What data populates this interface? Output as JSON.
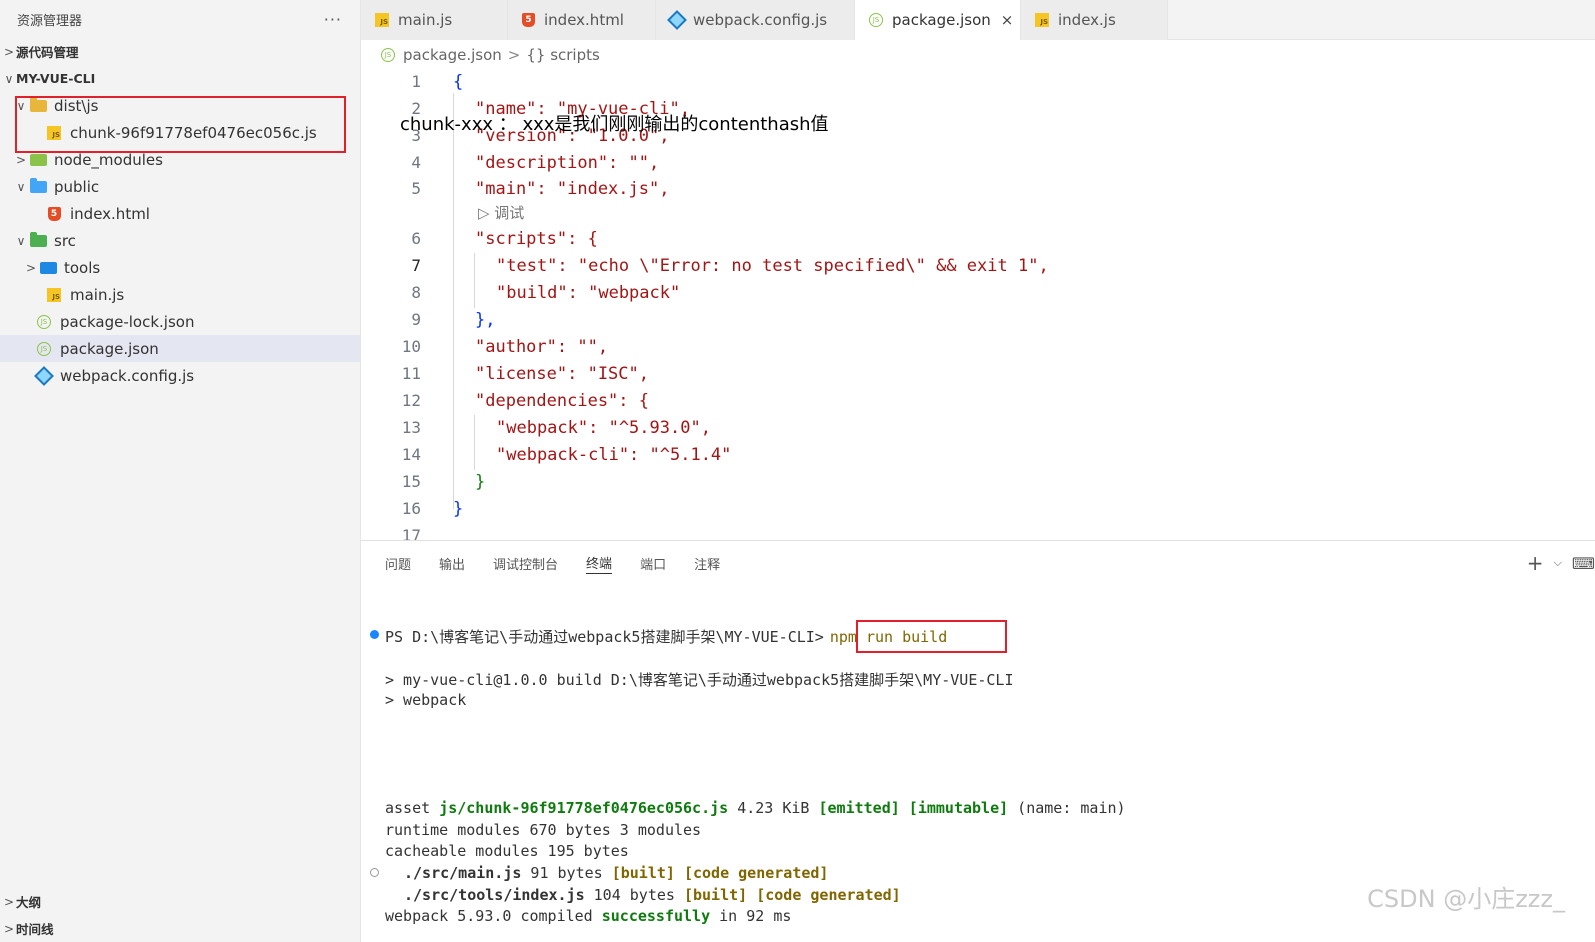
{
  "sidebar": {
    "title": "资源管理器",
    "more": "···",
    "sections": {
      "scm": "源代码管理",
      "project": "MY-VUE-CLI",
      "outline": "大纲",
      "timeline": "时间线"
    },
    "tree": [
      {
        "label": "dist\\js",
        "chev": "∨",
        "type": "folder"
      },
      {
        "label": "chunk-96f91778ef0476ec056c.js",
        "type": "js"
      },
      {
        "label": "node_modules",
        "chev": ">",
        "type": "folder"
      },
      {
        "label": "public",
        "chev": "∨",
        "type": "folder"
      },
      {
        "label": "index.html",
        "type": "html"
      },
      {
        "label": "src",
        "chev": "∨",
        "type": "folder"
      },
      {
        "label": "tools",
        "chev": ">",
        "type": "folder"
      },
      {
        "label": "main.js",
        "type": "js"
      },
      {
        "label": "package-lock.json",
        "type": "npm"
      },
      {
        "label": "package.json",
        "type": "npm",
        "selected": true
      },
      {
        "label": "webpack.config.js",
        "type": "webpack"
      }
    ]
  },
  "tabs": [
    {
      "label": "main.js",
      "icon": "js-icon"
    },
    {
      "label": "index.html",
      "icon": "html-icon"
    },
    {
      "label": "webpack.config.js",
      "icon": "webpack-icon"
    },
    {
      "label": "package.json",
      "icon": "npm-icon",
      "active": true,
      "close": "×"
    },
    {
      "label": "index.js",
      "icon": "js-icon"
    }
  ],
  "breadcrumb": {
    "file": "package.json",
    "sep": ">",
    "symbol": "{} scripts"
  },
  "annotation": "chunk-xxx  ： xxx是我们刚刚输出的contenthash值",
  "editor": {
    "codelens": "▷ 调试",
    "lines": [
      {
        "n": "1",
        "text": "{"
      },
      {
        "n": "2",
        "text": "\"name\": \"my-vue-cli\","
      },
      {
        "n": "3",
        "text": "\"version\": \"1.0.0\","
      },
      {
        "n": "4",
        "text": "\"description\": \"\","
      },
      {
        "n": "5",
        "text": "\"main\": \"index.js\","
      },
      {
        "n": "6",
        "text": "\"scripts\": {"
      },
      {
        "n": "7",
        "text": "\"test\": \"echo \\\"Error: no test specified\\\" && exit 1\","
      },
      {
        "n": "8",
        "text": "\"build\": \"webpack\""
      },
      {
        "n": "9",
        "text": "},"
      },
      {
        "n": "10",
        "text": "\"author\": \"\","
      },
      {
        "n": "11",
        "text": "\"license\": \"ISC\","
      },
      {
        "n": "12",
        "text": "\"dependencies\": {"
      },
      {
        "n": "13",
        "text": "\"webpack\": \"^5.93.0\","
      },
      {
        "n": "14",
        "text": "\"webpack-cli\": \"^5.1.4\""
      },
      {
        "n": "15",
        "text": "}"
      },
      {
        "n": "16",
        "text": "}"
      },
      {
        "n": "17",
        "text": ""
      }
    ]
  },
  "panel": {
    "tabs": [
      "问题",
      "输出",
      "调试控制台",
      "终端",
      "端口",
      "注释"
    ],
    "active_tab": "终端",
    "actions": {
      "add": "+",
      "dropdown": "⌵",
      "terminal": "⌨"
    },
    "terminal": {
      "prompt": "PS D:\\博客笔记\\手动通过webpack5搭建脚手架\\MY-VUE-CLI>",
      "command": "npm run build",
      "out1": "> my-vue-cli@1.0.0 build D:\\博客笔记\\手动通过webpack5搭建脚手架\\MY-VUE-CLI",
      "out2": "> webpack",
      "asset_prefix": "asset ",
      "asset_name": "js/chunk-96f91778ef0476ec056c.js",
      "asset_size": " 4.23 KiB ",
      "asset_emitted": "[emitted]",
      "asset_immutable": "[immutable]",
      "asset_suffix": " (name: main)",
      "runtime": "runtime modules 670 bytes 3 modules",
      "cacheable": "cacheable modules 195 bytes",
      "mod1_name": "./src/main.js",
      "mod1_size": " 91 bytes ",
      "mod2_name": "./src/tools/index.js",
      "mod2_size": " 104 bytes ",
      "built": "[built]",
      "codegen": "[code generated]",
      "compiled_prefix": "webpack 5.93.0 compiled ",
      "compiled_status": "successfully",
      "compiled_suffix": " in 92 ms"
    }
  },
  "watermark": "CSDN @小庄zzz_"
}
